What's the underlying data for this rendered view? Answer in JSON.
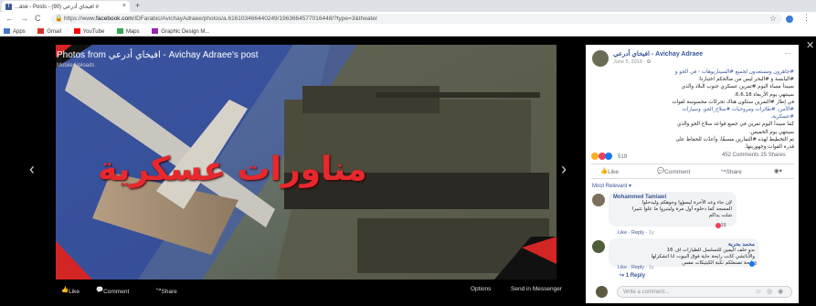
{
  "browser": {
    "tab_title": "...ase - Posts - افيخاي أدرعي (90) #",
    "tab_close": "×",
    "new_tab": "+",
    "back": "←",
    "forward": "→",
    "reload": "C",
    "url_host": "facebook.com",
    "url_path": "/IDFarabic/AvichayAdraee/photos/a.616103466440249/1963664577016448/?type=3&theater",
    "url_scheme": "https://www.",
    "star": "☆",
    "menu": "⋮",
    "bookmarks": [
      {
        "label": "Apps",
        "color": "#4a76c4"
      },
      {
        "label": "Gmail",
        "color": "#d93025"
      },
      {
        "label": "YouTube",
        "color": "#ff0000"
      },
      {
        "label": "Maps",
        "color": "#34a853"
      },
      {
        "label": "Graphic Design M...",
        "color": "#9c27b0"
      }
    ]
  },
  "photo": {
    "title": "Photos from افيخاي أدرعي - Avichay Adraee's post",
    "subtitle": "Mobile Uploads",
    "overlay_text": "مناورات عسكرية",
    "prev_arrow": "‹",
    "next_arrow": "›",
    "bar": {
      "like": "Like",
      "comment": "Comment",
      "share": "Share",
      "options": "Options",
      "send": "Send in Messenger"
    }
  },
  "post": {
    "author": "افيخاي أدرعي - Avichay Adraee",
    "date": "June 5, 2018 · ✿",
    "more": "···",
    "text_lines": [
      "#جاهزون ومستعدون لجميع #السيناريوهات - في الجو و",
      "#اليابسة و #البحر ليس من صالحكم اختبارنا:",
      "سيبدأ مساء اليوم #تمرين عسكري جنوب البلاد والذي",
      "سينتهي يوم الأربعاء 6.6.18.",
      "في إطار #التمرين ستكون هناك تحركات محسوسة لقوات",
      "#الأمن، #طائرات ومروحيات #سلاح_الجو، وسيارات",
      "#عسكرية.",
      "كما سيبدأ اليوم تمرين في جميع قواعد سلاح الجو والذي",
      "سينتهي يوم الخميس.",
      "تم التخطيط لهذه #التمارين مسبقًا، وأعدّت للحفاظ على",
      "قدرة القوات وجهوزيتها."
    ],
    "reaction_count": "519",
    "comments_count": "452 Comments",
    "shares_count": "25 Shares",
    "action_like": "Like",
    "action_comment": "Comment",
    "action_share": "Share",
    "most_relevant": "Most Relevant ▾"
  },
  "comments": [
    {
      "name": "Mohammed Tamlawi",
      "text_lines": [
        "لإن جاء وعد الآخرة ليسؤوا وجوهكم وليدخلوا",
        "المسجد كما دخلوه أول مرة وليتبروا ما علوا تتبيرا"
      ],
      "extra": "شلت يداكم",
      "reaction": "38",
      "like": "Like",
      "reply": "Reply",
      "age": "1y"
    },
    {
      "name": "محمد بحرية",
      "text_lines": [
        "بدو خلف اليمين للتسلسل للطيارات اف 16",
        "والأباتشي كانت رايحة جاية فوق البيوت انا اتشكرلها",
        "رايحة تصنعلكم نكبة الكيتيكات مفس"
      ],
      "extra": "",
      "reaction": "6",
      "like": "Like",
      "reply": "Reply",
      "age": "1y"
    }
  ],
  "replies_link": "↪ 1 Reply",
  "write_placeholder": "Write a comment...",
  "write_icons": "☺ ◎ ◉"
}
